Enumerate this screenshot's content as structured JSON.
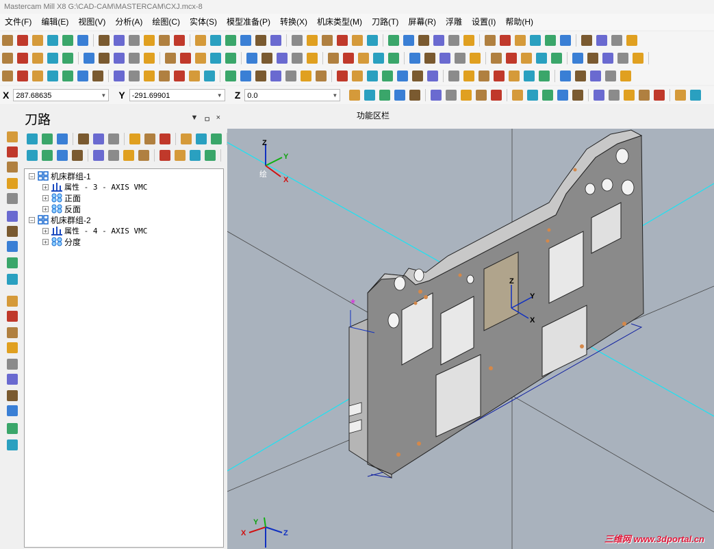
{
  "window": {
    "title": "Mastercam Mill X8  G:\\CAD-CAM\\MASTERCAM\\CXJ.mcx-8"
  },
  "menu": [
    "文件(F)",
    "编辑(E)",
    "视图(V)",
    "分析(A)",
    "绘图(C)",
    "实体(S)",
    "模型准备(P)",
    "转换(X)",
    "机床类型(M)",
    "刀路(T)",
    "屏幕(R)",
    "浮雕",
    "设置(I)",
    "帮助(H)"
  ],
  "coords": {
    "x_label": "X",
    "x_value": "287.68635",
    "y_label": "Y",
    "y_value": "-291.69901",
    "z_label": "Z",
    "z_value": "0.0"
  },
  "panel": {
    "title": "刀路",
    "pin": "ㅁ",
    "close": "×",
    "tree": [
      {
        "label": "机床群组-1",
        "level": 0
      },
      {
        "label": "属性 - 3 - AXIS VMC",
        "level": 1
      },
      {
        "label": "正面",
        "level": 1
      },
      {
        "label": "反面",
        "level": 1
      },
      {
        "label": "机床群组-2",
        "level": 0
      },
      {
        "label": "属性 - 4 - AXIS VMC",
        "level": 1
      },
      {
        "label": "分度",
        "level": 1
      }
    ]
  },
  "viewport": {
    "header": "功能区栏",
    "gview_label": "绘",
    "axis_top": {
      "x": "X",
      "y": "Y",
      "z": "Z"
    },
    "axis_bottom": {
      "x": "X",
      "y": "Y",
      "z": "Z"
    },
    "watermark": "三维网 www.3dportal.cn"
  },
  "colors": {
    "viewport_bg": "#a9b2bd",
    "part_gray": "#8a8a8a",
    "cyan_line": "#22e0f0",
    "axis_x": "#d01010",
    "axis_y": "#10b010",
    "axis_z": "#1030c0"
  }
}
